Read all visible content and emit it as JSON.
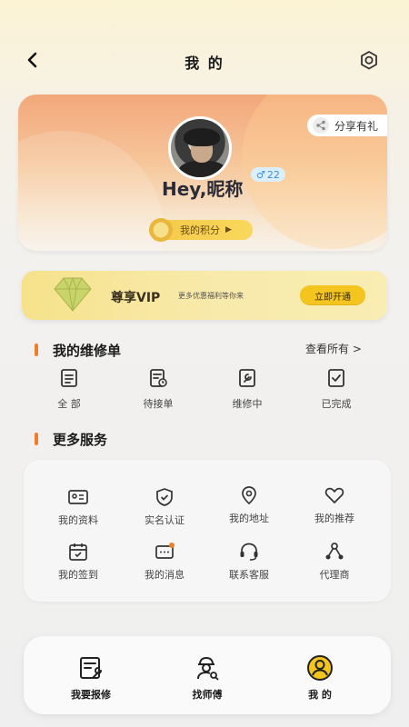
{
  "header": {
    "title": "我 的",
    "back_icon": "chevron-left-icon",
    "settings_icon": "settings-gear-icon"
  },
  "profile": {
    "share_label": "分享有礼",
    "nickname": "Hey,昵称",
    "gender_symbol": "♂",
    "age": "22",
    "points_label": "我的积分"
  },
  "vip": {
    "title": "尊享VIP",
    "subtitle": "更多优惠福利等你来",
    "button": "立即开通"
  },
  "repair_orders": {
    "title": "我的维修单",
    "see_all": "查看所有 >",
    "items": [
      {
        "label": "全 部",
        "icon": "clipboard-list-icon"
      },
      {
        "label": "待接单",
        "icon": "clipboard-clock-icon"
      },
      {
        "label": "维修中",
        "icon": "clipboard-wrench-icon"
      },
      {
        "label": "已完成",
        "icon": "clipboard-check-icon"
      }
    ]
  },
  "more_services": {
    "title": "更多服务",
    "items": [
      {
        "label": "我的资料",
        "icon": "id-card-icon"
      },
      {
        "label": "实名认证",
        "icon": "shield-check-icon"
      },
      {
        "label": "我的地址",
        "icon": "location-pin-icon"
      },
      {
        "label": "我的推荐",
        "icon": "heart-icon"
      },
      {
        "label": "我的签到",
        "icon": "calendar-check-icon"
      },
      {
        "label": "我的消息",
        "icon": "message-icon"
      },
      {
        "label": "联系客服",
        "icon": "headset-icon"
      },
      {
        "label": "代理商",
        "icon": "network-icon"
      }
    ]
  },
  "bottom_nav": {
    "items": [
      {
        "label": "我要报修",
        "icon": "repair-form-icon"
      },
      {
        "label": "找师傅",
        "icon": "worker-search-icon"
      },
      {
        "label": "我 的",
        "icon": "user-circle-icon"
      }
    ]
  },
  "colors": {
    "accent_orange": "#ee7f2a",
    "vip_button": "#f3c51e",
    "badge_blue": "#3f8fd8"
  }
}
